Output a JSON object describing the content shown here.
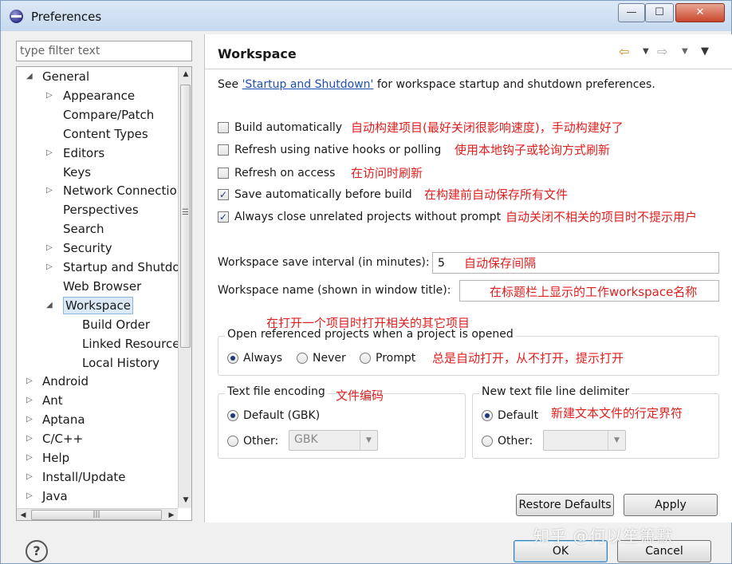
{
  "window": {
    "title": "Preferences",
    "min_glyph": "—",
    "max_glyph": "☐",
    "close_glyph": "✕"
  },
  "filter": {
    "placeholder": "type filter text"
  },
  "tree": {
    "items": [
      {
        "label": "General",
        "arrow": "◢"
      },
      {
        "label": "Appearance",
        "arrow": "▷"
      },
      {
        "label": "Compare/Patch",
        "arrow": ""
      },
      {
        "label": "Content Types",
        "arrow": ""
      },
      {
        "label": "Editors",
        "arrow": "▷"
      },
      {
        "label": "Keys",
        "arrow": ""
      },
      {
        "label": "Network Connectio",
        "arrow": "▷"
      },
      {
        "label": "Perspectives",
        "arrow": ""
      },
      {
        "label": "Search",
        "arrow": ""
      },
      {
        "label": "Security",
        "arrow": "▷"
      },
      {
        "label": "Startup and Shutdov",
        "arrow": "▷"
      },
      {
        "label": "Web Browser",
        "arrow": ""
      },
      {
        "label": "Workspace",
        "arrow": "◢",
        "selected": true
      },
      {
        "label": "Build Order",
        "arrow": ""
      },
      {
        "label": "Linked Resource",
        "arrow": ""
      },
      {
        "label": "Local History",
        "arrow": ""
      },
      {
        "label": "Android",
        "arrow": "▷"
      },
      {
        "label": "Ant",
        "arrow": "▷"
      },
      {
        "label": "Aptana",
        "arrow": "▷"
      },
      {
        "label": "C/C++",
        "arrow": "▷"
      },
      {
        "label": "Help",
        "arrow": "▷"
      },
      {
        "label": "Install/Update",
        "arrow": "▷"
      },
      {
        "label": "Java",
        "arrow": "▷"
      }
    ],
    "scroll": {
      "up": "▲",
      "down": "▼",
      "grip": "☰",
      "left": "◀",
      "right": "▶",
      "hgrip": "|||"
    }
  },
  "page": {
    "title": "Workspace",
    "nav": {
      "back": "⇦",
      "back_menu": "▼",
      "forward": "⇨",
      "forward_menu": "▼",
      "view_menu": "▼"
    },
    "description": {
      "prefix": "See ",
      "link": "'Startup and Shutdown'",
      "suffix": " for workspace startup and shutdown preferences."
    },
    "checkboxes": [
      {
        "label": "Build automatically",
        "checked": false,
        "note": "自动构建项目(最好关闭很影响速度)，手动构建好了"
      },
      {
        "label": "Refresh using native hooks or polling",
        "checked": false,
        "note": "使用本地钩子或轮询方式刷新"
      },
      {
        "label": "Refresh on access",
        "checked": false,
        "note": "在访问时刷新"
      },
      {
        "label": "Save automatically before build",
        "checked": true,
        "note": "在构建前自动保存所有文件"
      },
      {
        "label": "Always close unrelated projects without prompt",
        "checked": true,
        "note": "自动关闭不相关的项目时不提示用户"
      }
    ],
    "check_glyph": "✓",
    "save_interval": {
      "label": "Workspace save interval (in minutes):",
      "value": "5",
      "note": "自动保存间隔"
    },
    "workspace_name": {
      "label": "Workspace name (shown in window title):",
      "value": "",
      "note": "在标题栏上显示的工作workspace名称"
    },
    "open_referenced": {
      "note": "在打开一个项目时打开相关的其它项目",
      "title": "Open referenced projects when a project is opened",
      "options": [
        {
          "label": "Always",
          "selected": true
        },
        {
          "label": "Never",
          "selected": false
        },
        {
          "label": "Prompt",
          "selected": false
        }
      ],
      "options_note": "总是自动打开，从不打开，提示打开"
    },
    "encoding": {
      "title": "Text file encoding",
      "note": "文件编码",
      "default_label": "Default (GBK)",
      "other_label": "Other:",
      "other_value": "GBK"
    },
    "line_delimiter": {
      "title": "New text file line delimiter",
      "default_label": "Default",
      "note": "新建文本文件的行定界符",
      "other_label": "Other:",
      "other_value": ""
    },
    "combo_arrow": "▼",
    "restore_defaults": "Restore Defaults",
    "apply": "Apply"
  },
  "footer": {
    "help": "?",
    "ok": "OK",
    "cancel": "Cancel",
    "watermark": "知乎 @何以笙箫默"
  }
}
